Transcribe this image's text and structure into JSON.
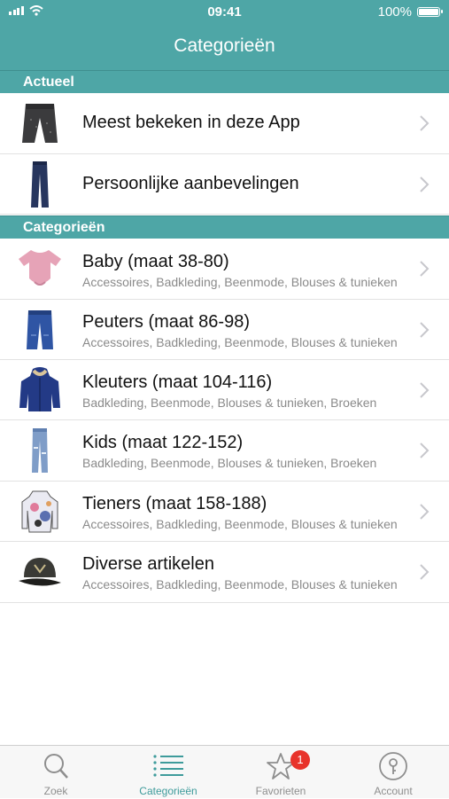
{
  "status_bar": {
    "time": "09:41",
    "battery": "100%"
  },
  "nav": {
    "title": "Categorieën"
  },
  "sections": {
    "actueel": {
      "header": "Actueel",
      "items": [
        {
          "title": "Meest bekeken in deze App"
        },
        {
          "title": "Persoonlijke aanbevelingen"
        }
      ]
    },
    "categorieen": {
      "header": "Categorieën",
      "items": [
        {
          "title": "Baby (maat 38-80)",
          "subtitle": "Accessoires, Badkleding, Beenmode, Blouses & tunieken"
        },
        {
          "title": "Peuters (maat 86-98)",
          "subtitle": "Accessoires, Badkleding, Beenmode, Blouses & tunieken"
        },
        {
          "title": "Kleuters (maat 104-116)",
          "subtitle": "Badkleding, Beenmode, Blouses & tunieken, Broeken"
        },
        {
          "title": "Kids (maat 122-152)",
          "subtitle": "Badkleding, Beenmode, Blouses & tunieken, Broeken"
        },
        {
          "title": "Tieners (maat 158-188)",
          "subtitle": "Accessoires, Badkleding, Beenmode, Blouses & tunieken"
        },
        {
          "title": "Diverse artikelen",
          "subtitle": "Accessoires, Badkleding, Beenmode, Blouses & tunieken"
        }
      ]
    }
  },
  "tabbar": {
    "tabs": [
      {
        "label": "Zoek"
      },
      {
        "label": "Categorieën"
      },
      {
        "label": "Favorieten",
        "badge": "1"
      },
      {
        "label": "Account"
      }
    ]
  },
  "colors": {
    "accent": "#4ea6a6",
    "active_tab": "#3e9b9b",
    "badge": "#e8332b"
  }
}
